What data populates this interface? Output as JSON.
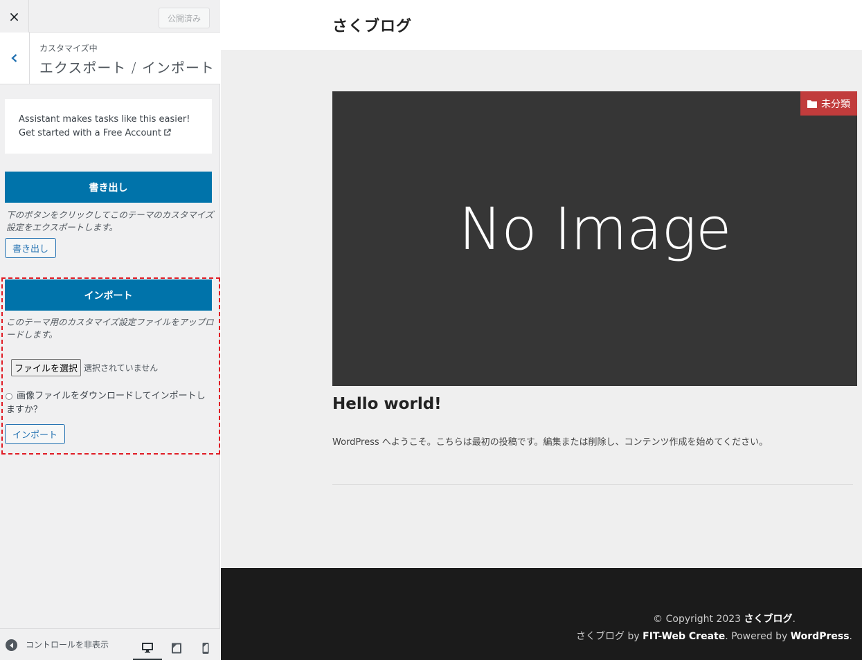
{
  "topbar": {
    "close_icon": "×",
    "publish_label": "公開済み"
  },
  "section": {
    "kicker": "カスタマイズ中",
    "title": "エクスポート / インポート"
  },
  "promo": {
    "line1": "Assistant makes tasks like this easier!",
    "line2": "Get started with a Free Account"
  },
  "export": {
    "heading": "書き出し",
    "description": "下のボタンをクリックしてこのテーマのカスタマイズ設定をエクスポートします。",
    "button_label": "書き出し"
  },
  "import": {
    "heading": "インポート",
    "description": "このテーマ用のカスタマイズ設定ファイルをアップロードします。",
    "file_button_label": "ファイルを選択",
    "file_status": "選択されていません",
    "checkbox_label": "画像ファイルをダウンロードしてインポートしますか？",
    "button_label": "インポート"
  },
  "footer_controls": {
    "collapse_label": "コントロールを非表示"
  },
  "preview": {
    "site_title": "さくブログ",
    "category_badge": "未分類",
    "no_image_text": "No Image",
    "post_title": "Hello world!",
    "post_excerpt": "WordPress へようこそ。こちらは最初の投稿です。編集または削除し、コンテンツ作成を始めてください。",
    "copyright_prefix": "© Copyright 2023",
    "copyright_site": "さくブログ",
    "copyright_suffix": ".",
    "credits_site": "さくブログ",
    "credits_by": " by ",
    "credits_theme": "FIT-Web Create",
    "credits_powered": ". Powered by ",
    "credits_wp": "WordPress",
    "credits_end": "."
  },
  "colors": {
    "accent": "#0073aa",
    "badge": "#c13c3c",
    "highlight_border": "#e01b24"
  }
}
